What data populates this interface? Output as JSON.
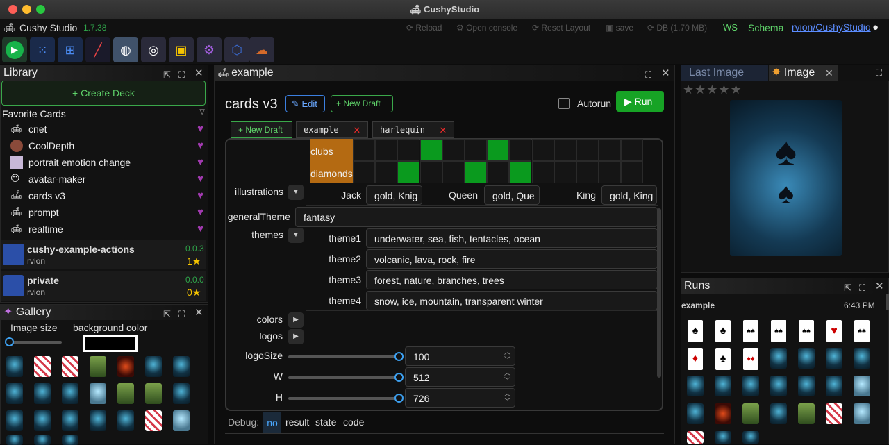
{
  "window": {
    "title": "CushyStudio"
  },
  "app": {
    "name": "Cushy Studio",
    "version": "1.7.38"
  },
  "menubar": {
    "reload": "Reload",
    "open_console": "Open console",
    "reset_layout": "Reset Layout",
    "save": "save",
    "db": "DB (1.70 MB)",
    "ws": "WS",
    "schema": "Schema",
    "repo": "rvion/CushyStudio"
  },
  "library": {
    "title": "Library",
    "create_deck": "Create Deck",
    "favorites_title": "Favorite Cards",
    "favorites": [
      "cnet",
      "CoolDepth",
      "portrait emotion change",
      "avatar-maker",
      "cards v3",
      "prompt",
      "realtime"
    ],
    "decks": [
      {
        "name": "cushy-example-actions",
        "author": "rvion",
        "version": "0.0.3",
        "stars": "1★"
      },
      {
        "name": "private",
        "author": "rvion",
        "version": "0.0.0",
        "stars": "0★"
      }
    ]
  },
  "gallery": {
    "title": "Gallery",
    "image_size": "Image size",
    "background_color": "background color"
  },
  "editor": {
    "panel_title": "example",
    "card_title": "cards v3",
    "edit": "Edit",
    "new_draft": "New Draft",
    "autorun": "Autorun",
    "run": "Run",
    "tabs": {
      "new_draft": "New Draft",
      "t1": "example",
      "t2": "harlequin"
    },
    "grid_rows": [
      "clubs",
      "diamonds"
    ],
    "illustrations_label": "illustrations",
    "illus": {
      "jack": "Jack",
      "jack_val": "gold, Knig",
      "queen": "Queen",
      "queen_val": "gold, Que",
      "king": "King",
      "king_val": "gold, King"
    },
    "general_theme_label": "generalTheme",
    "general_theme": "fantasy",
    "themes_label": "themes",
    "themes": [
      {
        "k": "theme1",
        "v": "underwater, sea, fish, tentacles, ocean"
      },
      {
        "k": "theme2",
        "v": "volcanic, lava, rock, fire"
      },
      {
        "k": "theme3",
        "v": "forest, nature, branches, trees"
      },
      {
        "k": "theme4",
        "v": "snow, ice, mountain, transparent winter"
      }
    ],
    "colors_label": "colors",
    "logos_label": "logos",
    "sliders": [
      {
        "k": "logoSize",
        "v": "100"
      },
      {
        "k": "W",
        "v": "512"
      },
      {
        "k": "H",
        "v": "726"
      }
    ],
    "debug": {
      "label": "Debug:",
      "no": "no",
      "result": "result",
      "state": "state",
      "code": "code"
    }
  },
  "image_panel": {
    "tab_last": "Last Image",
    "tab_image": "Image",
    "rating": "★★★★★"
  },
  "runs": {
    "title": "Runs",
    "name": "example",
    "time": "6:43 PM"
  },
  "colors": {
    "accent_green": "#17a325",
    "link_blue": "#3b92f0"
  }
}
